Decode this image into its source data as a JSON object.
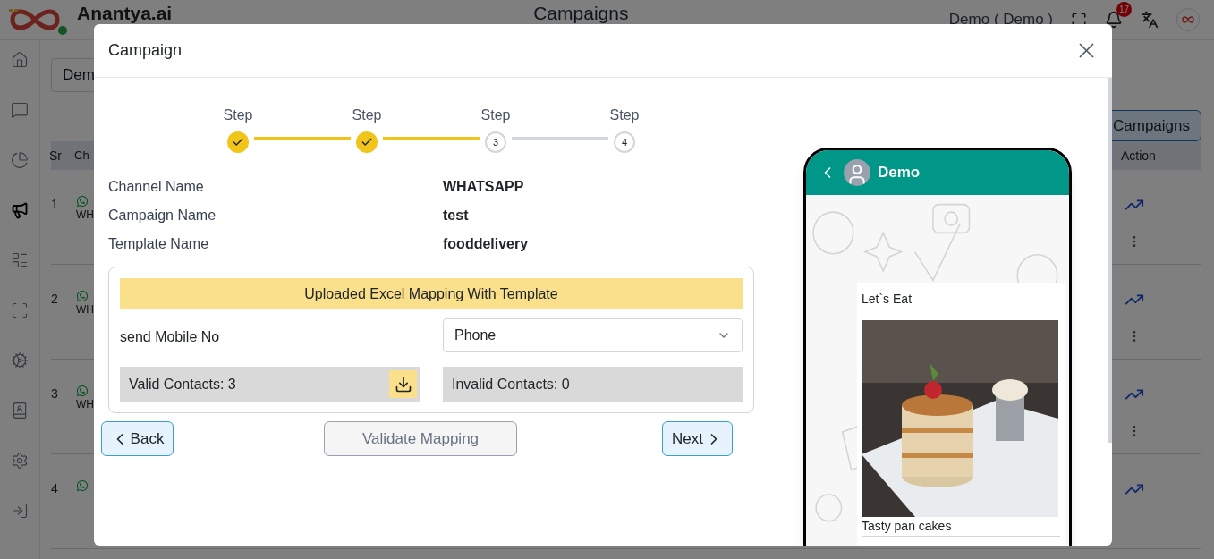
{
  "app": {
    "brand": "Anantya.ai",
    "page_title": "Campaigns",
    "user": "Demo ( Demo )",
    "notifications": "17"
  },
  "sidebar": {
    "items": [
      {
        "selected": false
      },
      {
        "selected": false
      },
      {
        "selected": false
      },
      {
        "selected": true
      },
      {
        "selected": false
      },
      {
        "selected": false
      },
      {
        "selected": false
      },
      {
        "selected": false
      },
      {
        "selected": false
      },
      {
        "selected": false
      }
    ]
  },
  "filter_field": {
    "value": "Dem"
  },
  "campaigns_button": "Campaigns",
  "table": {
    "columns": [
      "Sr",
      "Ch",
      "Action"
    ],
    "rows": [
      {
        "sr": "1",
        "channel": "WH",
        "more_menu": true
      },
      {
        "sr": "2",
        "channel": "WH",
        "more_menu": true
      },
      {
        "sr": "3",
        "channel": "WH",
        "more_menu": true
      },
      {
        "sr": "4",
        "more_menu": false
      }
    ]
  },
  "modal": {
    "title": "Campaign",
    "steps": [
      {
        "label": "Step",
        "completed": true
      },
      {
        "label": "Step",
        "completed": true
      },
      {
        "label": "Step",
        "number": "3",
        "completed": false
      },
      {
        "label": "Step",
        "number": "4",
        "completed": false
      }
    ],
    "details": [
      {
        "label": "Channel Name",
        "value": "WHATSAPP"
      },
      {
        "label": "Campaign Name",
        "value": "test"
      },
      {
        "label": "Template Name",
        "value": "fooddelivery"
      }
    ],
    "mapping": {
      "title": "Uploaded Excel Mapping With Template",
      "field_label": "send Mobile No",
      "select_value": "Phone",
      "valid": "Valid Contacts: 3",
      "invalid": "Invalid Contacts: 0"
    },
    "buttons": {
      "back": "Back",
      "validate": {
        "label": "Validate Mapping",
        "disabled": true
      },
      "next": "Next"
    },
    "preview": {
      "contact": "Demo",
      "header_text": "Let`s Eat",
      "caption": "Tasty pan cakes"
    }
  }
}
